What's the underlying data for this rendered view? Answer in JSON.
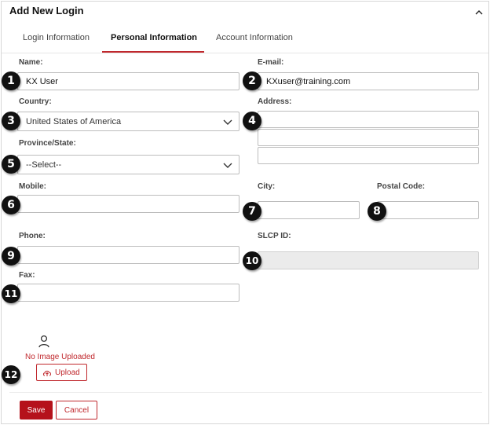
{
  "dialog": {
    "title": "Add New Login"
  },
  "tabs": [
    {
      "label": "Login Information"
    },
    {
      "label": "Personal Information",
      "active": true
    },
    {
      "label": "Account Information"
    }
  ],
  "form": {
    "name": {
      "label": "Name:",
      "value": "KX User"
    },
    "email": {
      "label": "E-mail:",
      "value": "KXuser@training.com"
    },
    "country": {
      "label": "Country:",
      "value": "United States of America"
    },
    "address": {
      "label": "Address:",
      "line1": "",
      "line2": "",
      "line3": ""
    },
    "province": {
      "label": "Province/State:",
      "value": "--Select--"
    },
    "mobile": {
      "label": "Mobile:",
      "value": ""
    },
    "city": {
      "label": "City:",
      "value": ""
    },
    "postal_code": {
      "label": "Postal Code:",
      "value": ""
    },
    "phone": {
      "label": "Phone:",
      "value": ""
    },
    "slcp_id": {
      "label": "SLCP ID:",
      "value": ""
    },
    "fax": {
      "label": "Fax:",
      "value": ""
    }
  },
  "image": {
    "status": "No Image Uploaded",
    "upload_label": "Upload"
  },
  "footer": {
    "save_label": "Save",
    "cancel_label": "Cancel"
  },
  "callouts": [
    "1",
    "2",
    "3",
    "4",
    "5",
    "6",
    "7",
    "8",
    "9",
    "10",
    "11",
    "12"
  ],
  "colors": {
    "accent": "#c0282d",
    "primary_button": "#b5121b",
    "callout": "#111111",
    "disabled_field": "#ebebeb"
  },
  "icons": [
    "chevron-up-icon",
    "chevron-down-icon",
    "user-icon",
    "cloud-upload-icon"
  ]
}
